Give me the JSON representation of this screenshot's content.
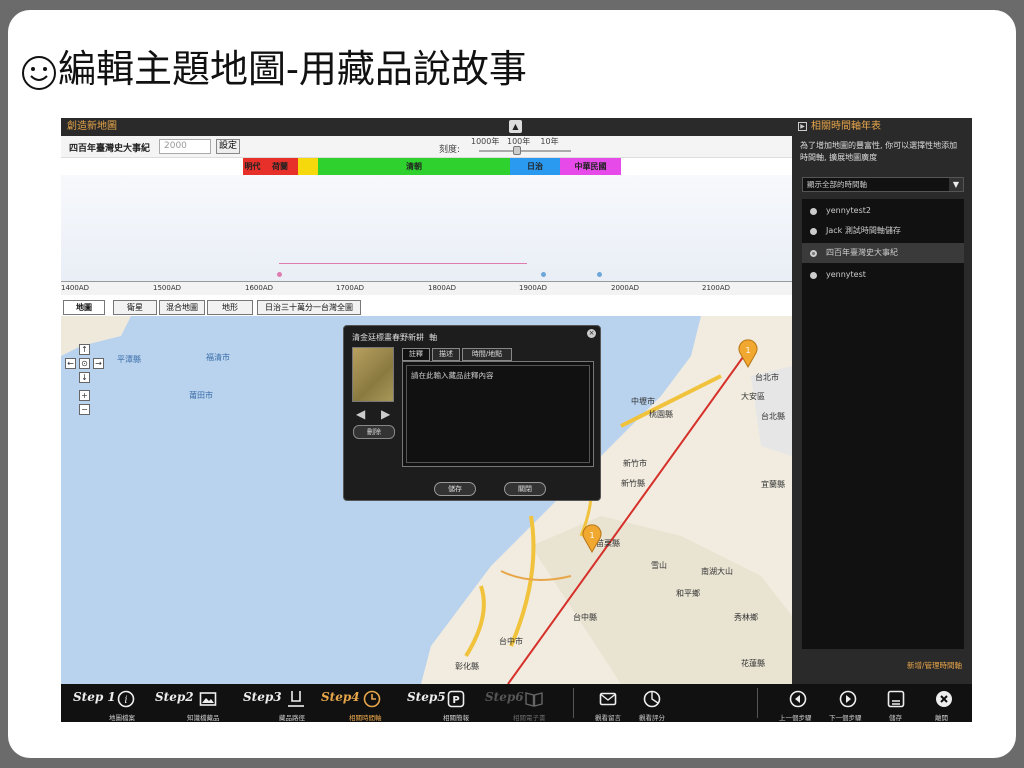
{
  "slide": {
    "title": "編輯主題地圖-用藏品說故事"
  },
  "main": {
    "title": "創造新地圖",
    "up_button": "▲",
    "timeline_name": "四百年臺灣史大事紀",
    "year_input_value": "2000",
    "set_button": "設定",
    "scale_label": "刻度:",
    "scale_marks": "1000年   100年    10年",
    "eras": [
      {
        "label": "明代",
        "color": "#e8302a"
      },
      {
        "label": "荷蘭",
        "color": "#e8302a"
      },
      {
        "label": "",
        "color": "#f5d90c"
      },
      {
        "label": "清朝",
        "color": "#2fd12f"
      },
      {
        "label": "日治",
        "color": "#2a9af0"
      },
      {
        "label": "中華民國",
        "color": "#e64ae8"
      }
    ],
    "ticks": [
      "1400AD",
      "1500AD",
      "1600AD",
      "1700AD",
      "1800AD",
      "1900AD",
      "2000AD",
      "2100AD"
    ],
    "map_tabs": [
      "地圖",
      "衛星",
      "混合地圖",
      "地形",
      "日治三十萬分一台灣全圖"
    ]
  },
  "map": {
    "labels": {
      "taipei": "台北市",
      "taoyuan": "桃園縣",
      "zhongli": "中壢市",
      "xinzhu": "新竹縣",
      "yilan": "宜蘭縣",
      "taizhong": "台中縣",
      "taizhongshi": "台中市",
      "zhanghua": "彰化縣",
      "nantou": "南湖大山",
      "snowmt": "雪山",
      "hualian": "花蓮縣",
      "miaoli": "苗栗縣",
      "taibeixian": "台北縣",
      "daan": "大安區",
      "xingyi": "新竹市",
      "hepingxiang": "和平鄉",
      "xiulin": "秀林鄉"
    },
    "sea_labels": {
      "haitan": "平潭縣",
      "fujian": "福清市",
      "ningde": "莆田市"
    },
    "nav": {
      "up": "↑",
      "left": "←",
      "center": "⊙",
      "right": "→",
      "down": "↓",
      "plus": "+",
      "minus": "−"
    }
  },
  "dialog": {
    "title": "清金廷標畫春野新耕  軸",
    "tabs": [
      "註釋",
      "描述",
      "時間/地點"
    ],
    "placeholder": "請在此輸入藏品註釋內容",
    "delete": "刪除",
    "save": "儲存",
    "close": "關閉",
    "close_x": "×",
    "arrows": "◀ ▶"
  },
  "side": {
    "title": "相關時間軸年表",
    "description": "為了增加地圖的豐富性, 你可以選擇性地添加時間軸, 擴展地圖廣度",
    "select_value": "顯示全部的時間軸",
    "items": [
      "yennytest2",
      "Jack 測試時間軸儲存",
      "四百年臺灣史大事紀",
      "yennytest"
    ],
    "active_index": 2,
    "footer": "新增/管理時間軸"
  },
  "toolbar": {
    "steps": [
      {
        "label": "Step 1",
        "caption": "地圖檔案",
        "icon": "info-icon",
        "state": "done"
      },
      {
        "label": "Step2",
        "caption": "知識檔藏品",
        "icon": "image-icon",
        "state": "done"
      },
      {
        "label": "Step3",
        "caption": "藏品路徑",
        "icon": "path-icon",
        "state": "done"
      },
      {
        "label": "Step4",
        "caption": "相關時間軸",
        "icon": "clock-icon",
        "state": "current"
      },
      {
        "label": "Step5",
        "caption": "相關簡報",
        "icon": "presentation-icon",
        "state": "done"
      },
      {
        "label": "Step6",
        "caption": "相關電子書",
        "icon": "book-icon",
        "state": "disabled"
      }
    ],
    "extras": [
      {
        "caption": "觀看留言",
        "icon": "mail-icon"
      },
      {
        "caption": "觀看評分",
        "icon": "pie-icon"
      }
    ],
    "actions": [
      {
        "caption": "上一個步驟",
        "icon": "prev-icon"
      },
      {
        "caption": "下一個步驟",
        "icon": "next-icon"
      },
      {
        "caption": "儲存",
        "icon": "save-icon"
      },
      {
        "caption": "離開",
        "icon": "exit-icon"
      }
    ],
    "colors": {
      "current": "#e8a64a",
      "done": "#eeeeee",
      "disabled": "#555555"
    }
  }
}
